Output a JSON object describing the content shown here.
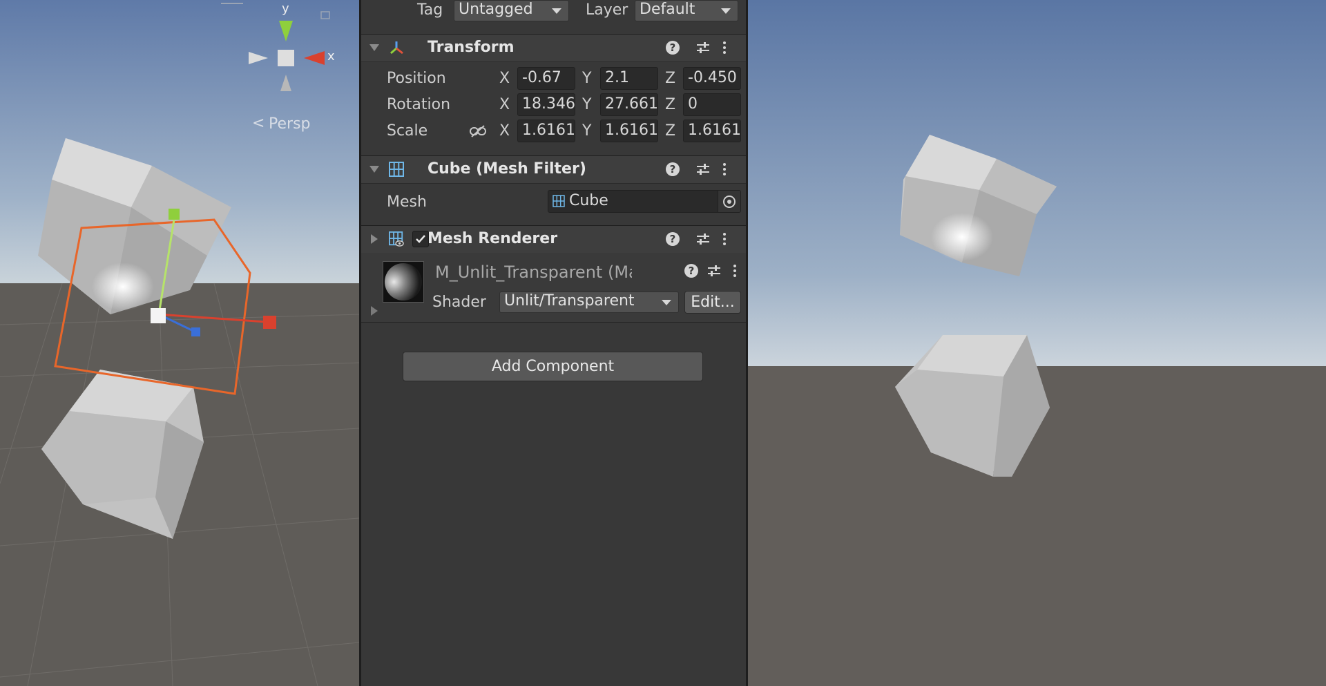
{
  "header": {
    "tag_label": "Tag",
    "tag_value": "Untagged",
    "layer_label": "Layer",
    "layer_value": "Default"
  },
  "scene": {
    "persp_label": "Persp",
    "gizmo_y": "y",
    "gizmo_x": "x"
  },
  "transform": {
    "title": "Transform",
    "position_label": "Position",
    "rotation_label": "Rotation",
    "scale_label": "Scale",
    "position": {
      "x": "-0.67",
      "y": "2.1",
      "z": "-0.450"
    },
    "rotation": {
      "x": "18.346",
      "y": "27.661",
      "z": "0"
    },
    "scale": {
      "x": "1.61611",
      "y": "1.61611",
      "z": "1.61611"
    },
    "axis_x": "X",
    "axis_y": "Y",
    "axis_z": "Z"
  },
  "mesh_filter": {
    "title": "Cube (Mesh Filter)",
    "mesh_label": "Mesh",
    "mesh_value": "Cube"
  },
  "mesh_renderer": {
    "title": "Mesh Renderer",
    "enabled": true
  },
  "material": {
    "name": "M_Unlit_Transparent (Materia",
    "shader_label": "Shader",
    "shader_value": "Unlit/Transparent",
    "edit_label": "Edit..."
  },
  "add_component_label": "Add Component",
  "colors": {
    "selection_outline": "#e8662a",
    "axis_x": "#d9412e",
    "axis_y": "#8fcf3c",
    "axis_z": "#3a6fd8",
    "panel_bg": "#383838"
  }
}
